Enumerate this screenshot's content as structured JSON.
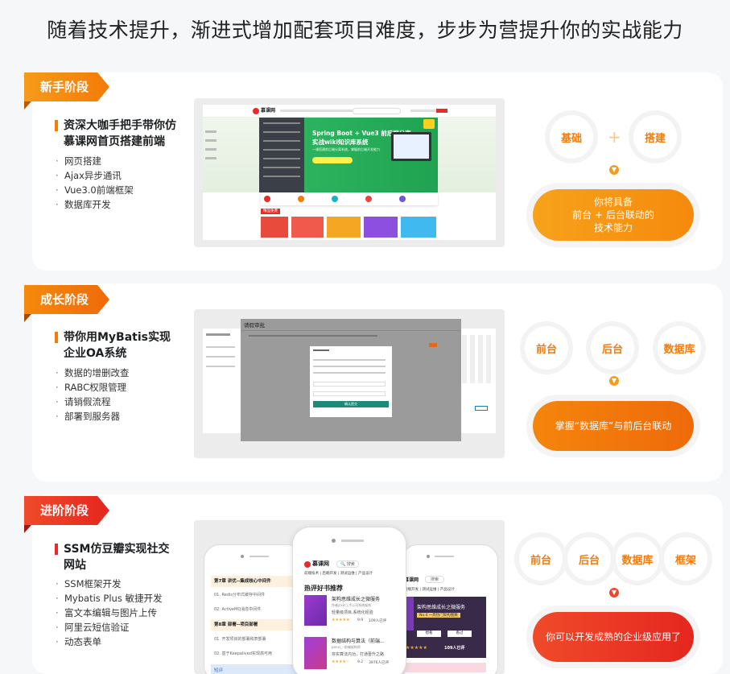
{
  "headline": "随着技术提升，渐进式增加配套项目难度，步步为营提升你的实战能力",
  "stages": [
    {
      "badge": "新手阶段",
      "title_line1": "资深大咖手把手带你仿",
      "title_line2": "慕课网首页搭建前端",
      "bullets": [
        "网页搭建",
        "Ajax异步通讯",
        "Vue3.0前端框架",
        "数据库开发"
      ],
      "skills": [
        "基础",
        "搭建"
      ],
      "plus": "+",
      "result_line1": "你将具备",
      "result_line2": "前台 + 后台联动的",
      "result_line3": "技术能力",
      "screenshot": {
        "logo": "慕课网",
        "banner_title": "Spring Boot + Vue3 前后端分离",
        "banner_sub": "实战wiki知识库系统",
        "banner_desc": "一课搭建前后端分离系统，掌握前后端开发能力",
        "section_label": "精品免费"
      }
    },
    {
      "badge": "成长阶段",
      "title_line1": "带你用MyBatis实现",
      "title_line2": "企业OA系统",
      "bullets": [
        "数据的增删改查",
        "RABC权限管理",
        "请销假流程",
        "部署到服务器"
      ],
      "skills": [
        "前台",
        "后台",
        "数据库"
      ],
      "result_line1": "掌握“数据库”与前后台联动",
      "screenshot": {
        "panel_title": "请假审批",
        "dialog_button": "确认提交"
      }
    },
    {
      "badge": "进阶阶段",
      "title_line1": "SSM仿豆瓣实现社交",
      "title_line2": "网站",
      "bullets": [
        "SSM框架开发",
        "Mybatis Plus 敏捷开发",
        "富文本编辑与图片上传",
        "阿里云短信验证",
        "动态表单"
      ],
      "skills": [
        "前台",
        "后台",
        "数据库",
        "框架"
      ],
      "result_line1": "你可以开发成熟的企业级应用了",
      "screenshot": {
        "left_chapter1": "第7章 讲优--集成核心中间件",
        "left_item1": "01. Redis分布式缓存中间件",
        "left_item2": "02. ActiveMQ消息中间件",
        "left_chapter2": "第8章 部署--项目部署",
        "left_item3": "01. 开发项目的部署和表部署",
        "left_item4": "02. 基于Keepalived实现高可用",
        "left_footer": "短评",
        "center_logo": "慕课网",
        "center_search": "搜索",
        "center_nav": "前端技术 | 后端开发 | 测试运维 | 产品设计",
        "center_section": "热评好书推荐",
        "book1_title": "架构思维成长之微服务",
        "book1_author": "作者jcxkl上手公司系统架构",
        "book1_desc": "轻量级项目,系统化经验",
        "book1_score": "9.9",
        "book1_reviews": "109人已评",
        "book2_title": "数据结构与算法（前端...",
        "book2_author": "panxi_--前端架构师",
        "book2_desc": "夯实算法内功，打通晋升之路",
        "book2_score": "9.2",
        "book2_reviews": "3976人已评",
        "right_logo": "慕课网",
        "right_search": "搜索",
        "right_nav": "后端开发 | 测试运维 | 产品设计",
        "right_book": "架构思维成长之微服务",
        "right_rank": "No.4  一周热门架构图数",
        "right_btn1": "想看",
        "right_btn2": "看过",
        "right_reviews": "109人已评"
      }
    }
  ],
  "colors": {
    "orange": "#f47b08",
    "orange_light": "#f59b1a",
    "red": "#e82b26",
    "banner_green": "#25b35a"
  }
}
